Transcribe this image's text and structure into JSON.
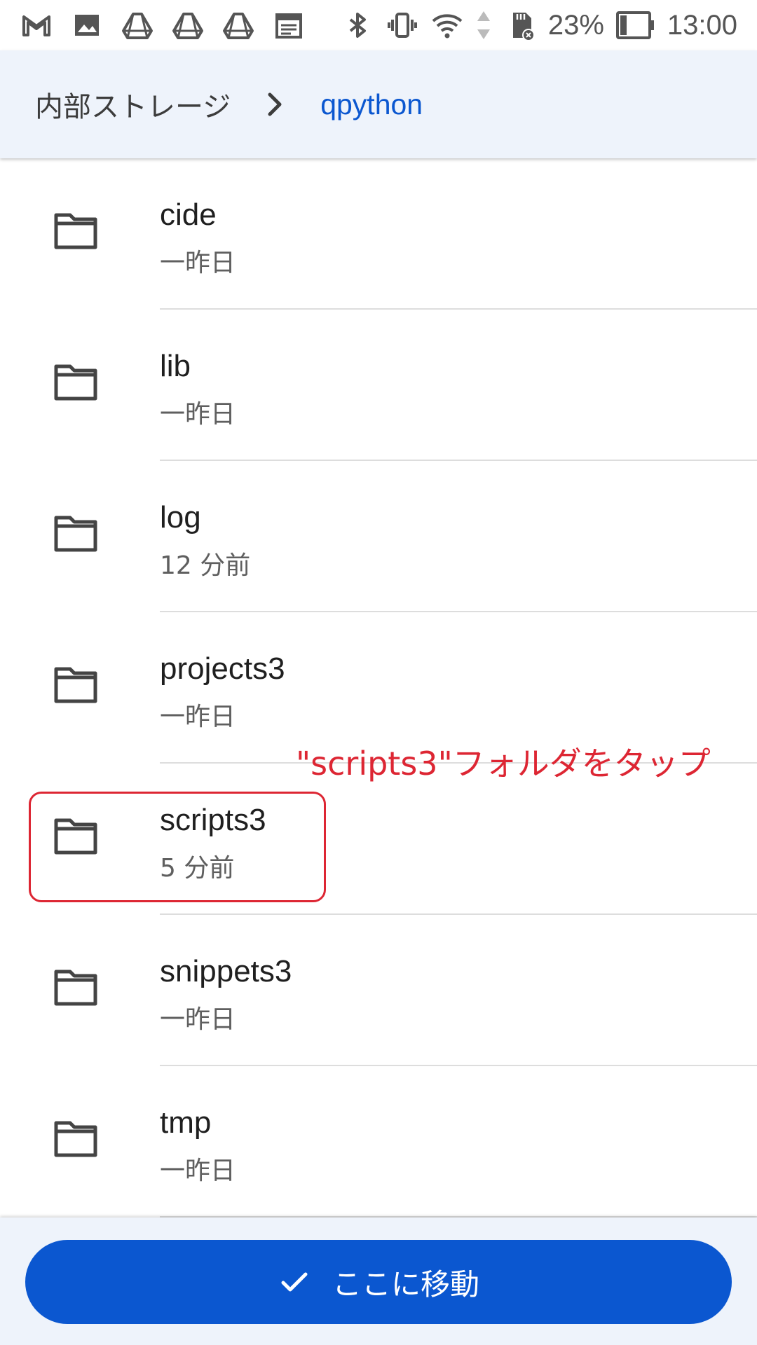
{
  "status_bar": {
    "left_icons": [
      "gmail-icon",
      "photos-icon",
      "drive-icon",
      "drive-icon",
      "drive-icon",
      "calendar-icon"
    ],
    "right_icons": [
      "bluetooth-icon",
      "vibrate-icon",
      "wifi-icon",
      "data-arrows-icon",
      "sd-card-error-icon",
      "battery-icon"
    ],
    "battery_percent": "23%",
    "time": "13:00"
  },
  "breadcrumb": {
    "root": "内部ストレージ",
    "current": "qpython"
  },
  "folders": [
    {
      "name": "cide",
      "modified": "一昨日"
    },
    {
      "name": "lib",
      "modified": "一昨日"
    },
    {
      "name": "log",
      "modified": "12 分前"
    },
    {
      "name": "projects3",
      "modified": "一昨日"
    },
    {
      "name": "scripts3",
      "modified": "5 分前"
    },
    {
      "name": "snippets3",
      "modified": "一昨日"
    },
    {
      "name": "tmp",
      "modified": "一昨日"
    }
  ],
  "annotation": {
    "text": "\"scripts3\"フォルダをタップ",
    "color": "#dd2633"
  },
  "action": {
    "move_label": "ここに移動"
  },
  "colors": {
    "accent": "#0b57d0",
    "header_bg": "#eef3fb",
    "annotation": "#dd2633"
  }
}
